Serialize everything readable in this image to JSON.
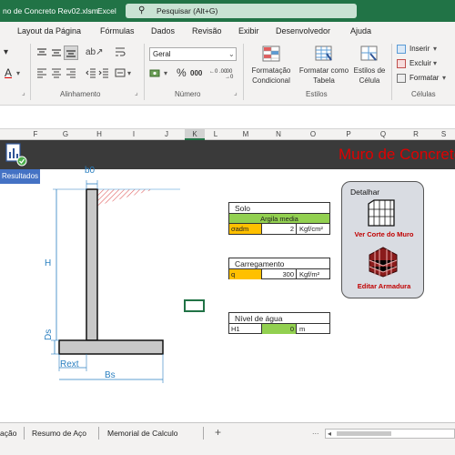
{
  "titlebar": {
    "filename": "no de Concreto Rev02.xlsm",
    "separator": "-",
    "app": "Excel",
    "search_placeholder": "Pesquisar (Alt+G)"
  },
  "menu": {
    "items": [
      "Layout da Página",
      "Fórmulas",
      "Dados",
      "Revisão",
      "Exibir",
      "Desenvolvedor",
      "Ajuda"
    ]
  },
  "ribbon": {
    "alinhamento_label": "Alinhamento",
    "numero_label": "Número",
    "estilos_label": "Estilos",
    "celulas_label": "Células",
    "number_format": "Geral",
    "percent": "%",
    "thousands": "000",
    "dec_inc": "←0 .00",
    "dec_dec": ".00 →0",
    "formatacao_1": "Formatação",
    "formatacao_2": "Condicional",
    "formatar_tabela_1": "Formatar como",
    "formatar_tabela_2": "Tabela",
    "estilos_celula_1": "Estilos de",
    "estilos_celula_2": "Célula",
    "inserir": "Inserir",
    "excluir": "Excluir",
    "formatar": "Formatar"
  },
  "columns": [
    "F",
    "G",
    "H",
    "I",
    "J",
    "K",
    "L",
    "M",
    "N",
    "O",
    "P",
    "Q",
    "R",
    "S"
  ],
  "sheet": {
    "resultados_button": "Resultados",
    "title": "Muro de Concreto",
    "dims": {
      "b0": "b0",
      "H": "H",
      "Ds": "Ds",
      "Rext": "Rext",
      "Bs": "Bs"
    },
    "solo": {
      "header": "Solo",
      "type": "Argila media",
      "symbol": "σadm",
      "value": "2",
      "unit": "Kgf/cm²"
    },
    "carregamento": {
      "header": "Carregamento",
      "symbol": "q",
      "value": "300",
      "unit": "Kgf/m²"
    },
    "nivel": {
      "header": "Nível de água",
      "symbol": "H1",
      "value": "0",
      "unit": "m"
    },
    "panel": {
      "title": "Detalhar",
      "corte_label": "Ver Corte do Muro",
      "armadura_label": "Editar Armadura"
    }
  },
  "tabs": {
    "items": [
      "ação",
      "Resumo de Aço",
      "Memorial de Calculo"
    ],
    "add": "+",
    "ellipsis": "..."
  },
  "colors": {
    "excel_green": "#217346",
    "accent_red": "#e00000",
    "solo_green": "#92d050",
    "orange": "#ffc000"
  }
}
